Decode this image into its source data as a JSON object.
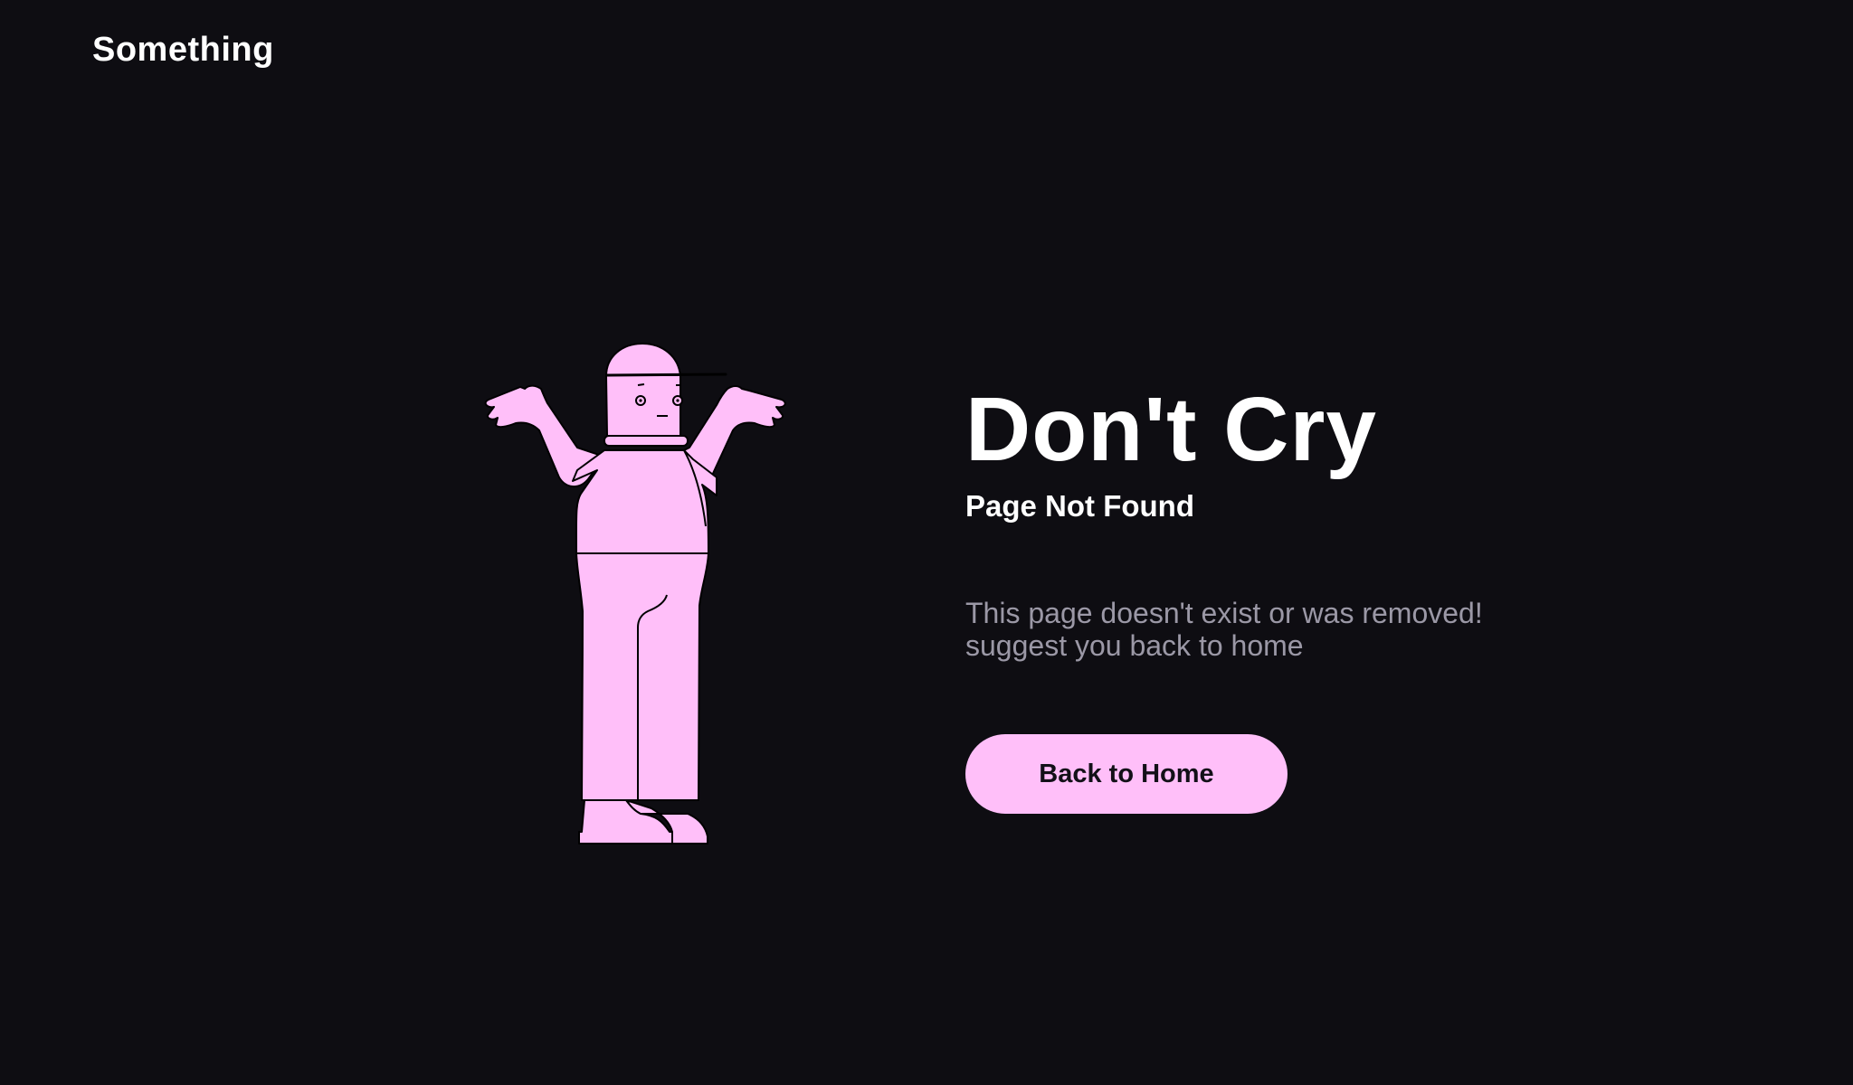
{
  "header": {
    "logo_text": "Something"
  },
  "main": {
    "title": "Don't Cry",
    "subtitle": "Page Not Found",
    "description_line1": "This page doesn't exist or was removed!",
    "description_line2": "suggest you back to home",
    "button_label": "Back to Home"
  },
  "illustration": {
    "icon": "shrugging-person-illustration"
  },
  "colors": {
    "background": "#0e0d12",
    "accent": "#ffbff9",
    "text_primary": "#ffffff",
    "text_secondary": "#9b98a6"
  }
}
